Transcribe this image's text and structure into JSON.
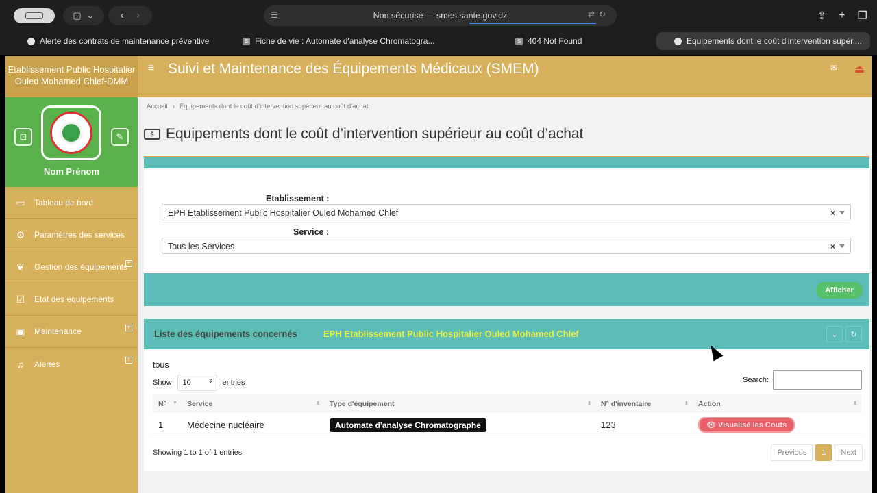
{
  "browser": {
    "address": "Non sécurisé — smes.sante.gov.dz",
    "tabs": [
      "Alerte des contrats de maintenance préventive",
      "Fiche de vie : Automate d'analyse Chromatogra...",
      "404 Not Found",
      "Equipements dont le coût d'intervention supéri..."
    ]
  },
  "sidebar": {
    "brand": "Etablissement Public Hospitalier Ouled Mohamed Chlef-DMM",
    "user_name": "Nom Prénom",
    "items": [
      {
        "label": "Tableau de bord",
        "icon": "monitor-icon"
      },
      {
        "label": "Paramètres des services",
        "icon": "gear-icon"
      },
      {
        "label": "Gestion des équipements",
        "icon": "leaf-icon"
      },
      {
        "label": "Etat des équipements",
        "icon": "check-icon"
      },
      {
        "label": "Maintenance",
        "icon": "briefcase-icon"
      },
      {
        "label": "Alertes",
        "icon": "bell-icon"
      }
    ]
  },
  "header": {
    "title": "Suivi et Maintenance des Équipements Médicaux (SMEM)"
  },
  "breadcrumb": {
    "home": "Accueil",
    "current": "Equipements dont le coût d’intervention supérieur au coût d’achat"
  },
  "page_title": "Equipements dont le coût d’intervention supérieur au coût d’achat",
  "filters": {
    "etab_label": "Etablissement :",
    "etab_value": "EPH Etablissement Public Hospitalier Ouled Mohamed Chlef",
    "service_label": "Service :",
    "service_value": "Tous les Services",
    "submit": "Afficher"
  },
  "panel": {
    "title": "Liste des équipements concernés",
    "establishment": "EPH Etablissement Public Hospitalier Ouled Mohamed Chlef",
    "filter_label": "tous",
    "show": "Show",
    "length": "10",
    "entries": "entries",
    "search_label": "Search:",
    "columns": [
      "N°",
      "Service",
      "Type d'équipement",
      "N° d'inventaire",
      "Action"
    ],
    "rows": [
      {
        "n": "1",
        "service": "Médecine nucléaire",
        "type": "Automate d'analyse Chromatographe",
        "inventaire": "123",
        "action": "Visualisé les Couts"
      }
    ],
    "info": "Showing 1 to 1 of 1 entries",
    "prev": "Previous",
    "page": "1",
    "next": "Next"
  },
  "colors": {
    "gold": "#d6b05a",
    "green": "#5ab04a",
    "teal": "#5cbcb6",
    "yellow_text": "#e8f04a"
  }
}
